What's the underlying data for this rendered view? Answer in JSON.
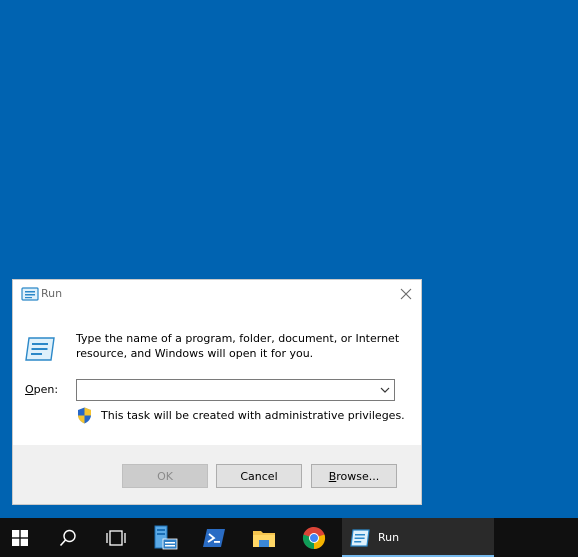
{
  "dialog": {
    "title": "Run",
    "description": "Type the name of a program, folder, document, or Internet resource, and Windows will open it for you.",
    "open_label_prefix": "O",
    "open_label_rest": "pen:",
    "open_value": "",
    "admin_note": "This task will be created with administrative privileges.",
    "ok_label": "OK",
    "cancel_label": "Cancel",
    "browse_label_prefix": "B",
    "browse_label_rest": "rowse..."
  },
  "taskbar": {
    "run_label": "Run",
    "icons": [
      "windows-start-icon",
      "search-icon",
      "task-view-icon",
      "server-manager-icon",
      "powershell-icon",
      "file-explorer-icon",
      "chrome-icon",
      "run-icon"
    ]
  },
  "colors": {
    "desktop": "#0063b1",
    "taskbar": "#101010",
    "accent": "#76b9ed"
  }
}
